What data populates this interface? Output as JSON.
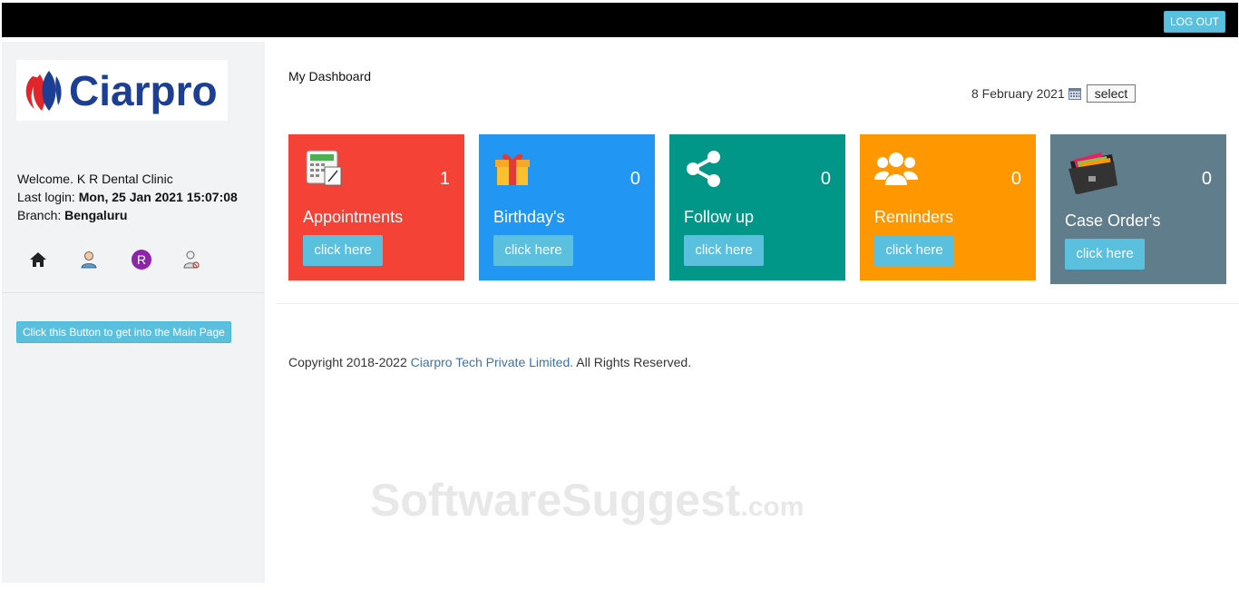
{
  "header": {
    "logout_label": "LOG OUT"
  },
  "sidebar": {
    "logo_text": "Ciarpro",
    "welcome_label": "Welcome.",
    "welcome_name": "K R Dental Clinic",
    "last_login_label": "Last login:",
    "last_login_value": "Mon, 25 Jan 2021 15:07:08",
    "branch_label": "Branch:",
    "branch_value": "Bengaluru",
    "nav_icons": [
      "home-icon",
      "user-icon",
      "registered-icon",
      "doctor-icon"
    ],
    "main_page_button": "Click this Button to get into the Main Page"
  },
  "main": {
    "title": "My Dashboard",
    "date": "8 February 2021",
    "select_label": "select",
    "cards": [
      {
        "label": "Appointments",
        "count": "1",
        "button": "click here",
        "color": "#f44336",
        "icon": "calculator-icon"
      },
      {
        "label": "Birthday's",
        "count": "0",
        "button": "click here",
        "color": "#2196f3",
        "icon": "gift-icon"
      },
      {
        "label": "Follow up",
        "count": "0",
        "button": "click here",
        "color": "#009688",
        "icon": "share-icon"
      },
      {
        "label": "Reminders",
        "count": "0",
        "button": "click here",
        "color": "#ff9800",
        "icon": "group-icon"
      },
      {
        "label": "Case Order's",
        "count": "0",
        "button": "click here",
        "color": "#607d8b",
        "icon": "file-folder-icon"
      }
    ]
  },
  "footer": {
    "copyright_prefix": "Copyright 2018-2022",
    "company_link": "Ciarpro Tech Private Limited.",
    "copyright_suffix": "All Rights Reserved."
  },
  "watermark": {
    "text": "SoftwareSuggest",
    "suffix": ".com"
  }
}
